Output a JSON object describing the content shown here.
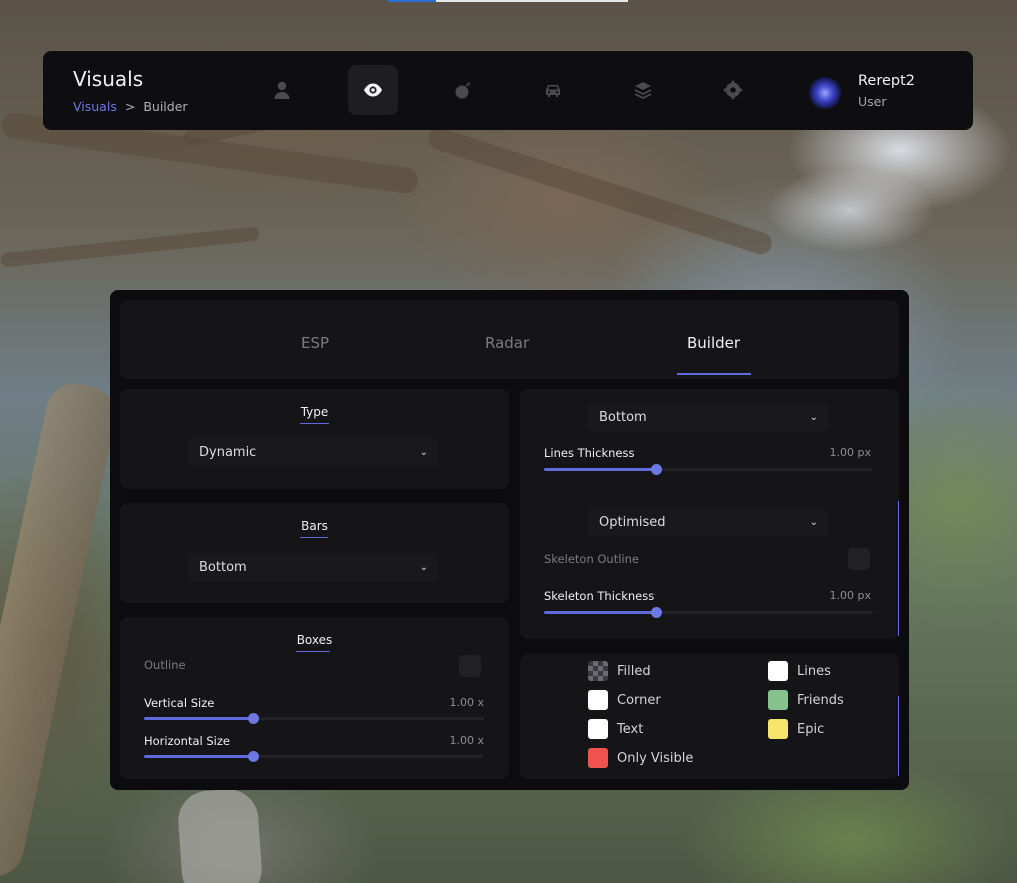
{
  "header": {
    "title": "Visuals",
    "breadcrumb": {
      "parent": "Visuals",
      "separator": ">",
      "current": "Builder"
    },
    "nav": [
      {
        "icon": "user-icon",
        "active": false
      },
      {
        "icon": "eye-icon",
        "active": true
      },
      {
        "icon": "bomb-icon",
        "active": false
      },
      {
        "icon": "car-icon",
        "active": false
      },
      {
        "icon": "layers-icon",
        "active": false
      },
      {
        "icon": "gear-icon",
        "active": false
      }
    ],
    "user": {
      "name": "Rerept2",
      "role": "User"
    }
  },
  "tabs": {
    "items": [
      "ESP",
      "Radar",
      "Builder"
    ],
    "active": "Builder"
  },
  "type_section": {
    "title": "Type",
    "select_value": "Dynamic"
  },
  "bars_section": {
    "title": "Bars",
    "select_value": "Bottom"
  },
  "boxes_section": {
    "title": "Boxes",
    "outline_label": "Outline",
    "outline_checked": false,
    "vertical": {
      "label": "Vertical Size",
      "value": "1.00 x",
      "fraction": 0.32
    },
    "horizontal": {
      "label": "Horizontal Size",
      "value": "1.00 x",
      "fraction": 0.32
    }
  },
  "lines_section": {
    "select_value": "Bottom",
    "thickness": {
      "label": "Lines Thickness",
      "value": "1.00 px",
      "fraction": 0.34
    }
  },
  "skeleton_section": {
    "select_value": "Optimised",
    "outline_label": "Skeleton Outline",
    "outline_checked": false,
    "thickness": {
      "label": "Skeleton Thickness",
      "value": "1.00 px",
      "fraction": 0.34
    }
  },
  "colors": {
    "items": [
      {
        "label": "Filled",
        "color": "checker"
      },
      {
        "label": "Lines",
        "color": "#ffffff"
      },
      {
        "label": "Corner",
        "color": "#ffffff"
      },
      {
        "label": "Friends",
        "color": "#86c28e"
      },
      {
        "label": "Text",
        "color": "#ffffff"
      },
      {
        "label": "Epic",
        "color": "#f5e56b"
      },
      {
        "label": "Only Visible",
        "color": "#f0524f"
      }
    ]
  },
  "theme": {
    "accent": "#5f6bdc",
    "panel": "#0c0c0e",
    "card": "#151517"
  }
}
